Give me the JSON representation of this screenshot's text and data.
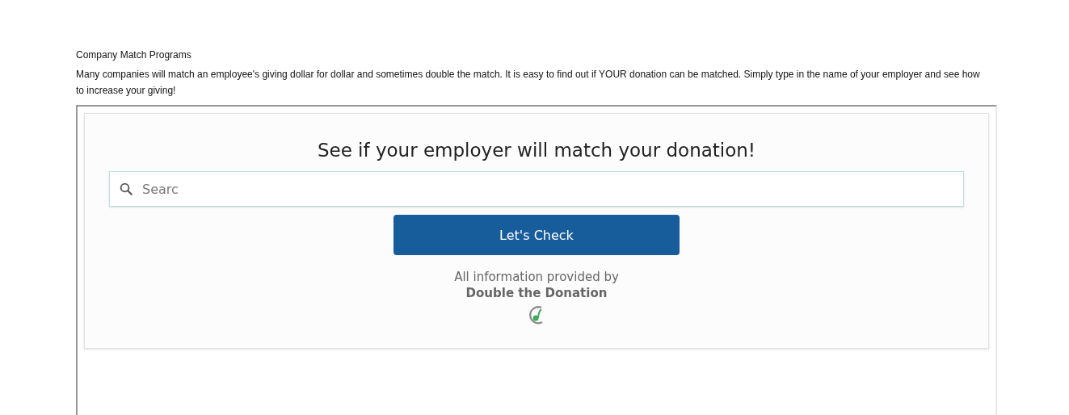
{
  "heading": "Company Match Programs",
  "intro": "Many companies will match an employee's giving dollar for dollar and sometimes double the match. It is easy to find out if YOUR donation can be matched. Simply type in the name of your employer and see how to increase your giving!",
  "widget": {
    "title": "See if your employer will match your donation!",
    "search": {
      "placeholder": "Searc"
    },
    "button": "Let's Check",
    "credit": "All information provided by",
    "provider": "Double the Donation"
  }
}
